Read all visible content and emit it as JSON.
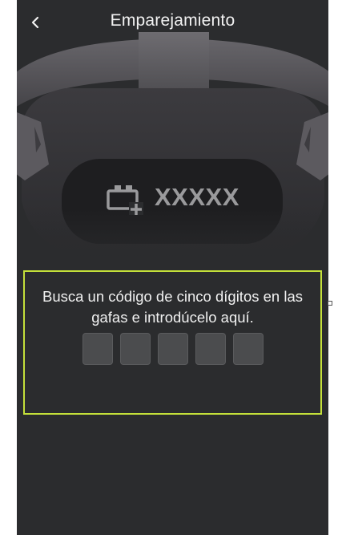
{
  "header": {
    "title": "Emparejamiento",
    "back_icon": "chevron-left-icon"
  },
  "illustration": {
    "code_placeholder": "XXXXX",
    "code_icon": "headset-code-icon"
  },
  "pairing": {
    "instructions": "Busca un código de cinco dígitos en las gafas e introdúcelo aquí.",
    "digits": [
      "",
      "",
      "",
      "",
      ""
    ]
  },
  "colors": {
    "background": "#2b2c2e",
    "highlight_border": "#c4e03a",
    "digit_box": "#4b4c4e",
    "text": "#f2f2f2"
  }
}
